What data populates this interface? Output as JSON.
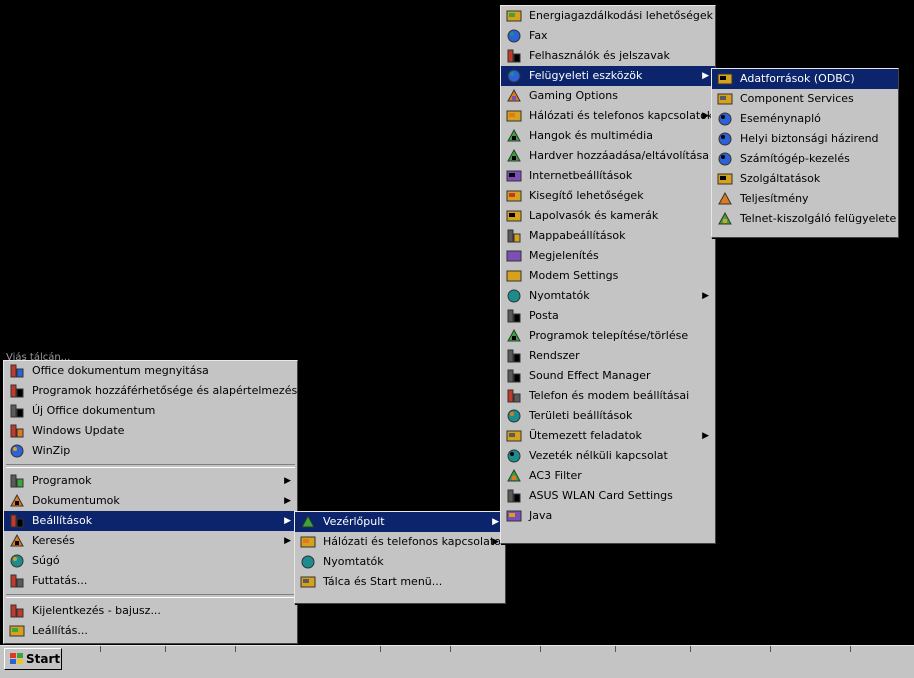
{
  "desktop": {
    "label": "Viás tálcán..."
  },
  "start_menu": {
    "top_items": [
      {
        "label": "Office dokumentum megnyitása",
        "icon": "office-open-icon"
      },
      {
        "label": "Programok hozzáférhetősége és alapértelmezései",
        "icon": "program-defaults-icon"
      },
      {
        "label": "Új Office dokumentum",
        "icon": "new-office-document-icon"
      },
      {
        "label": "Windows Update",
        "icon": "windows-update-icon"
      },
      {
        "label": "WinZip",
        "icon": "winzip-icon"
      }
    ],
    "main_items": [
      {
        "label": "Programok",
        "icon": "programs-icon",
        "submenu": true
      },
      {
        "label": "Dokumentumok",
        "icon": "documents-icon",
        "submenu": true
      },
      {
        "label": "Beállítások",
        "icon": "settings-icon",
        "submenu": true,
        "selected": true
      },
      {
        "label": "Keresés",
        "icon": "search-icon",
        "submenu": true
      },
      {
        "label": "Súgó",
        "icon": "help-icon"
      },
      {
        "label": "Futtatás...",
        "icon": "run-icon"
      }
    ],
    "bottom_items": [
      {
        "label": "Kijelentkezés - bajusz...",
        "icon": "logoff-icon"
      },
      {
        "label": "Leállítás...",
        "icon": "shutdown-icon"
      }
    ]
  },
  "settings_menu": {
    "items": [
      {
        "label": "Vezérlőpult",
        "icon": "control-panel-icon",
        "submenu": true,
        "selected": true
      },
      {
        "label": "Hálózati és telefonos kapcsolatok",
        "icon": "network-connections-icon",
        "submenu": true
      },
      {
        "label": "Nyomtatók",
        "icon": "printers-icon"
      },
      {
        "label": "Tálca és Start menü...",
        "icon": "taskbar-icon"
      }
    ]
  },
  "control_panel_menu": {
    "items": [
      {
        "label": "Energiagazdálkodási lehetőségek",
        "icon": "power-options-icon"
      },
      {
        "label": "Fax",
        "icon": "fax-icon"
      },
      {
        "label": "Felhasználók és jelszavak",
        "icon": "users-passwords-icon"
      },
      {
        "label": "Felügyeleti eszközök",
        "icon": "admin-tools-icon",
        "submenu": true,
        "selected": true
      },
      {
        "label": "Gaming Options",
        "icon": "gaming-options-icon"
      },
      {
        "label": "Hálózati és telefonos kapcsolatok",
        "icon": "network-connections-icon",
        "submenu": true
      },
      {
        "label": "Hangok és multimédia",
        "icon": "sounds-multimedia-icon"
      },
      {
        "label": "Hardver hozzáadása/eltávolítása",
        "icon": "add-hardware-icon"
      },
      {
        "label": "Internetbeállítások",
        "icon": "internet-options-icon"
      },
      {
        "label": "Kisegítő lehetőségek",
        "icon": "accessibility-icon"
      },
      {
        "label": "Lapolvasók és kamerák",
        "icon": "scanners-cameras-icon"
      },
      {
        "label": "Mappabeállítások",
        "icon": "folder-options-icon"
      },
      {
        "label": "Megjelenítés",
        "icon": "display-icon"
      },
      {
        "label": "Modem Settings",
        "icon": "modem-settings-icon"
      },
      {
        "label": "Nyomtatók",
        "icon": "printers-icon",
        "submenu": true
      },
      {
        "label": "Posta",
        "icon": "mail-icon"
      },
      {
        "label": "Programok telepítése/törlése",
        "icon": "add-remove-programs-icon"
      },
      {
        "label": "Rendszer",
        "icon": "system-icon"
      },
      {
        "label": "Sound Effect Manager",
        "icon": "sound-effect-manager-icon"
      },
      {
        "label": "Telefon és modem beállításai",
        "icon": "phone-modem-icon"
      },
      {
        "label": "Területi beállítások",
        "icon": "regional-settings-icon"
      },
      {
        "label": "Ütemezett feladatok",
        "icon": "scheduled-tasks-icon",
        "submenu": true
      },
      {
        "label": "Vezeték nélküli kapcsolat",
        "icon": "wireless-link-icon"
      },
      {
        "label": "AC3 Filter",
        "icon": "ac3-filter-icon"
      },
      {
        "label": "ASUS WLAN Card Settings",
        "icon": "asus-wlan-icon"
      },
      {
        "label": "Java",
        "icon": "java-icon"
      }
    ]
  },
  "admin_tools_menu": {
    "items": [
      {
        "label": "Adatforrások (ODBC)",
        "icon": "odbc-icon",
        "selected": true
      },
      {
        "label": "Component Services",
        "icon": "component-services-icon"
      },
      {
        "label": "Eseménynapló",
        "icon": "event-viewer-icon"
      },
      {
        "label": "Helyi biztonsági házirend",
        "icon": "local-security-policy-icon"
      },
      {
        "label": "Számítógép-kezelés",
        "icon": "computer-management-icon"
      },
      {
        "label": "Szolgáltatások",
        "icon": "services-icon"
      },
      {
        "label": "Teljesítmény",
        "icon": "performance-icon"
      },
      {
        "label": "Telnet-kiszolgáló felügyelete",
        "icon": "telnet-admin-icon"
      }
    ]
  },
  "taskbar": {
    "start_label": "Start"
  },
  "colors": {
    "selection": "#0b246b",
    "menu_bg": "#c4c4c4",
    "desktop": "#000000"
  }
}
